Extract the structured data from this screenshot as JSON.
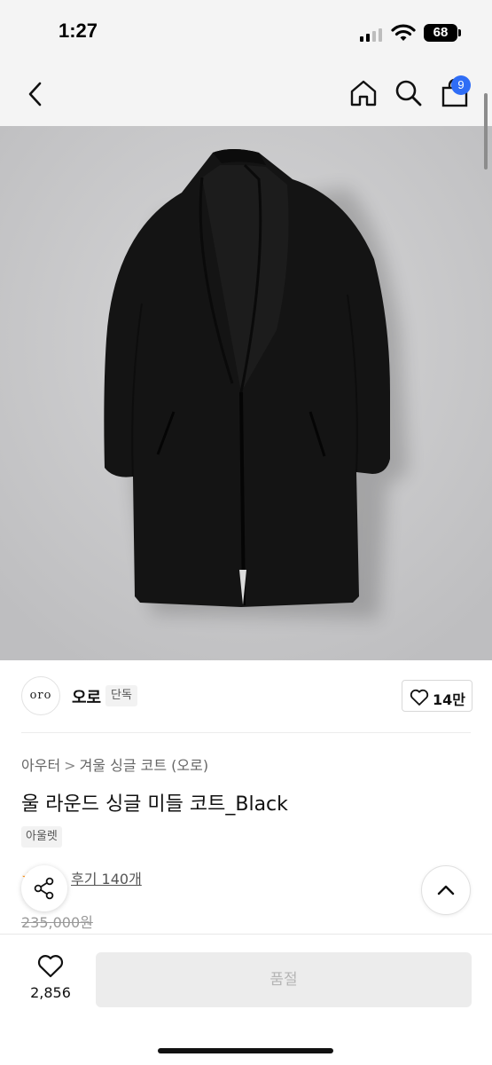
{
  "status_bar": {
    "time": "1:27",
    "battery": "68"
  },
  "header": {
    "cart_count": "9"
  },
  "brand": {
    "logo_text": "oro",
    "name": "오로",
    "tag": "단독",
    "likes": "14만"
  },
  "breadcrumb": {
    "category": "아우터",
    "separator": ">",
    "collection": "겨울 싱글 코트 (오로)"
  },
  "product": {
    "title": "울 라운드 싱글 미들 코트_Black",
    "tag": "아울렛",
    "rating_stars": "★★",
    "reviews": "후기 140개",
    "original_price": "235,000원"
  },
  "bottom_bar": {
    "wish_count": "2,856",
    "soldout_label": "품절"
  },
  "colors": {
    "accent": "#2f6df6",
    "rating": "#ff8a00",
    "coat": "#141414",
    "background_photo": "#c8c8ca"
  },
  "icons": [
    "back-icon",
    "home-icon",
    "search-icon",
    "cart-icon",
    "heart-icon",
    "share-icon",
    "chevron-up-icon"
  ]
}
